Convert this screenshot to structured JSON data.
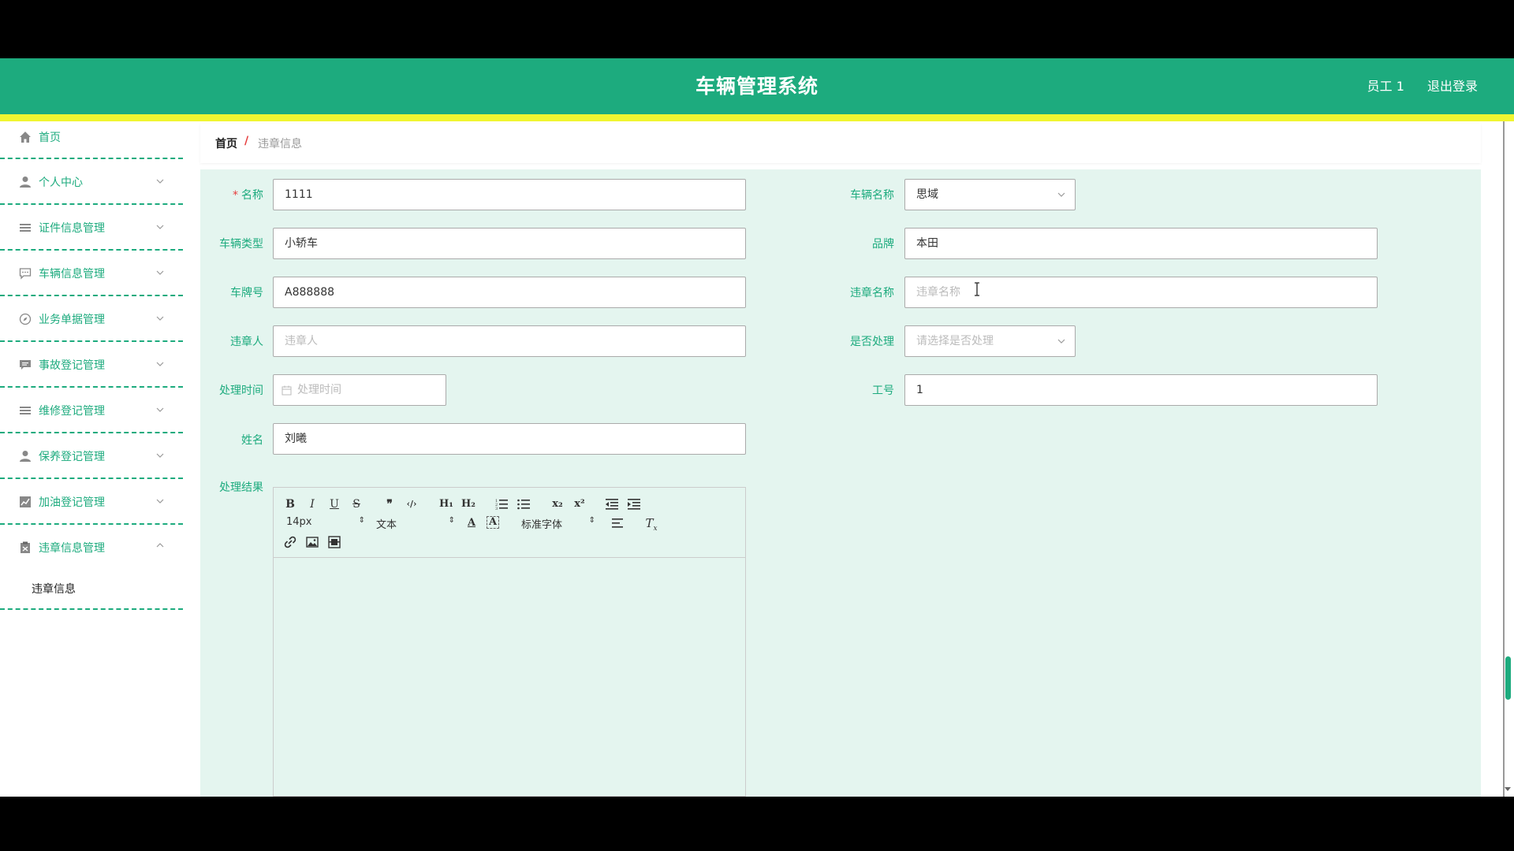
{
  "header": {
    "title": "车辆管理系统",
    "user": "员工 1",
    "logout": "退出登录"
  },
  "sidebar": {
    "items": [
      {
        "label": "首页",
        "icon": "home-icon"
      },
      {
        "label": "个人中心",
        "icon": "user-icon"
      },
      {
        "label": "证件信息管理",
        "icon": "list-icon"
      },
      {
        "label": "车辆信息管理",
        "icon": "chat-icon"
      },
      {
        "label": "业务单据管理",
        "icon": "compass-icon"
      },
      {
        "label": "事故登记管理",
        "icon": "message-icon"
      },
      {
        "label": "维修登记管理",
        "icon": "list-icon"
      },
      {
        "label": "保养登记管理",
        "icon": "user-icon"
      },
      {
        "label": "加油登记管理",
        "icon": "chart-icon"
      },
      {
        "label": "违章信息管理",
        "icon": "clipboard-icon"
      }
    ],
    "sub_items": [
      {
        "label": "违章信息"
      }
    ]
  },
  "breadcrumb": {
    "home": "首页",
    "separator": "/",
    "current": "违章信息"
  },
  "form": {
    "name": {
      "label": "名称",
      "value": "1111"
    },
    "vehicle_name": {
      "label": "车辆名称",
      "value": "思域"
    },
    "vehicle_type": {
      "label": "车辆类型",
      "value": "小轿车"
    },
    "brand": {
      "label": "品牌",
      "value": "本田"
    },
    "plate": {
      "label": "车牌号",
      "value": "A888888"
    },
    "violation_name": {
      "label": "违章名称",
      "placeholder": "违章名称"
    },
    "violator": {
      "label": "违章人",
      "placeholder": "违章人"
    },
    "handled": {
      "label": "是否处理",
      "placeholder": "请选择是否处理"
    },
    "handle_time": {
      "label": "处理时间",
      "placeholder": "处理时间"
    },
    "work_no": {
      "label": "工号",
      "value": "1"
    },
    "person_name": {
      "label": "姓名",
      "value": "刘曦"
    },
    "result": {
      "label": "处理结果"
    }
  },
  "editor": {
    "font_size": "14px",
    "text_style": "文本",
    "font_family": "标准字体"
  },
  "colors": {
    "primary": "#1dab7e",
    "stripe": "#f0f531",
    "panel": "#e4f5ef",
    "required": "#e63c3c"
  }
}
